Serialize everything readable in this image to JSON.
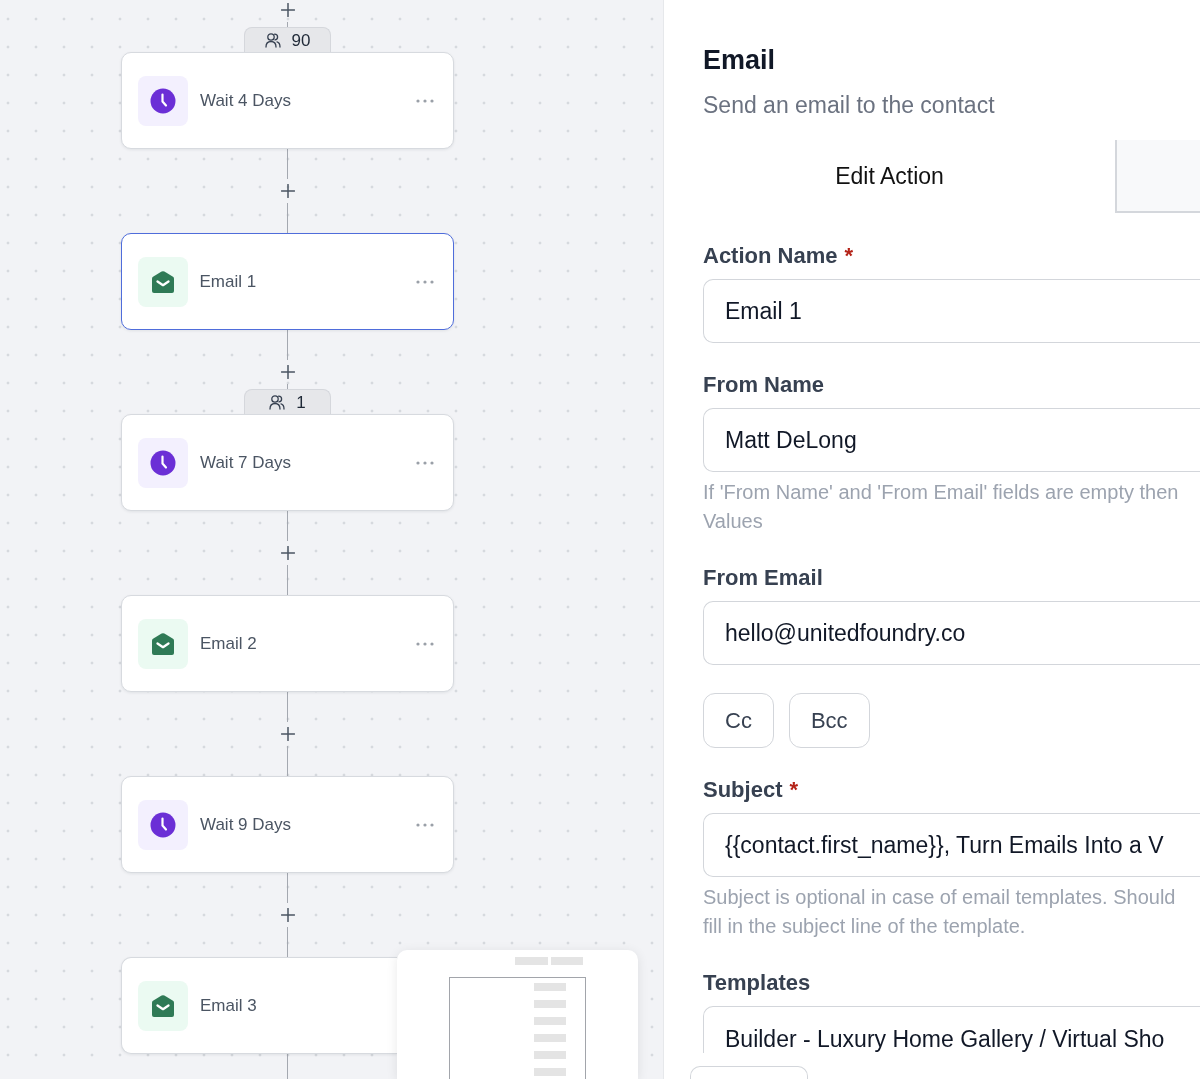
{
  "workflow": {
    "nodes": [
      {
        "kind": "wait",
        "title": "Wait 4 Days",
        "selected": false,
        "contacts": "90"
      },
      {
        "kind": "email",
        "title": "Email 1",
        "selected": true
      },
      {
        "kind": "wait",
        "title": "Wait 7 Days",
        "selected": false,
        "contacts": "1"
      },
      {
        "kind": "email",
        "title": "Email 2",
        "selected": false
      },
      {
        "kind": "wait",
        "title": "Wait 9 Days",
        "selected": false
      },
      {
        "kind": "email",
        "title": "Email 3",
        "selected": false
      }
    ]
  },
  "panel": {
    "title": "Email",
    "subtitle": "Send an email to the contact",
    "tabs": [
      {
        "label": "Edit Action",
        "selected": true
      },
      {
        "selected": false
      }
    ],
    "fields": [
      {
        "kind": "text",
        "label": "Action Name",
        "required_mark": "*",
        "value": "Email 1"
      },
      {
        "kind": "text",
        "label": "From Name",
        "value": "Matt DeLong",
        "help": "If 'From Name' and 'From Email' fields are empty then\nValues"
      },
      {
        "kind": "text",
        "label": "From Email",
        "value": "hello@unitedfoundry.co"
      },
      {
        "kind": "buttons",
        "buttons": [
          "Cc",
          "Bcc"
        ]
      },
      {
        "kind": "text",
        "label": "Subject",
        "required_mark": "*",
        "value": "{{contact.first_name}}, Turn Emails Into a V",
        "help": "Subject is optional in case of email templates. Should\nfill in the subject line of the template."
      },
      {
        "kind": "select",
        "label": "Templates",
        "value": "Builder - Luxury Home Gallery / Virtual Sho"
      }
    ]
  }
}
